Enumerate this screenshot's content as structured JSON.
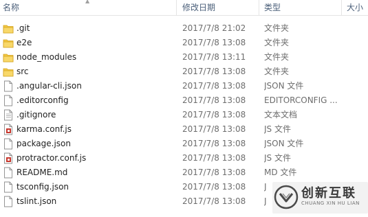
{
  "columns": {
    "name": "名称",
    "date": "修改日期",
    "type": "类型",
    "size": "大小"
  },
  "files": [
    {
      "name": ".git",
      "date": "2017/7/8 21:02",
      "type": "文件夹",
      "icon": "folder-icon"
    },
    {
      "name": "e2e",
      "date": "2017/7/8 13:08",
      "type": "文件夹",
      "icon": "folder-icon"
    },
    {
      "name": "node_modules",
      "date": "2017/7/8 13:11",
      "type": "文件夹",
      "icon": "folder-icon"
    },
    {
      "name": "src",
      "date": "2017/7/8 13:08",
      "type": "文件夹",
      "icon": "folder-icon"
    },
    {
      "name": ".angular-cli.json",
      "date": "2017/7/8 13:08",
      "type": "JSON 文件",
      "icon": "file-icon"
    },
    {
      "name": ".editorconfig",
      "date": "2017/7/8 13:08",
      "type": "EDITORCONFIG ...",
      "icon": "file-icon"
    },
    {
      "name": ".gitignore",
      "date": "2017/7/8 13:08",
      "type": "文本文档",
      "icon": "text-file-icon"
    },
    {
      "name": "karma.conf.js",
      "date": "2017/7/8 13:08",
      "type": "JS 文件",
      "icon": "js-file-icon"
    },
    {
      "name": "package.json",
      "date": "2017/7/8 13:08",
      "type": "JSON 文件",
      "icon": "file-icon"
    },
    {
      "name": "protractor.conf.js",
      "date": "2017/7/8 13:08",
      "type": "JS 文件",
      "icon": "js-file-icon"
    },
    {
      "name": "README.md",
      "date": "2017/7/8 13:08",
      "type": "MD 文件",
      "icon": "file-icon"
    },
    {
      "name": "tsconfig.json",
      "date": "2017/7/8 13:08",
      "type": "J",
      "icon": "file-icon"
    },
    {
      "name": "tslint.json",
      "date": "2017/7/8 13:08",
      "type": "J",
      "icon": "file-icon"
    }
  ],
  "watermark": {
    "title": "创新互联",
    "subtitle": "CHUANG XIN HU LIAN"
  },
  "colors": {
    "folder": "#f3c843",
    "header_text": "#4c607a",
    "detail_text": "#6d6d6d",
    "js_red": "#c8372d"
  }
}
